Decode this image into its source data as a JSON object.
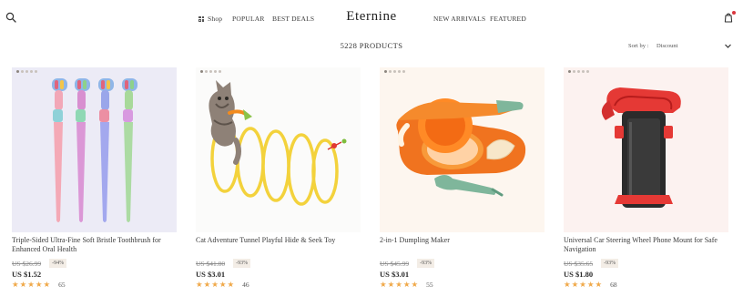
{
  "header": {
    "logo": "Eternine",
    "nav_left": [
      "Shop",
      "POPULAR",
      "BEST DEALS"
    ],
    "nav_right": [
      "NEW ARRIVALS",
      "FEATURED"
    ]
  },
  "toolbar": {
    "product_count": "5228 PRODUCTS",
    "sort_label": "Sort by :",
    "sort_value": "Discount"
  },
  "colors": {
    "star": "#f0a94a",
    "badge_bg": "#f3ede6"
  },
  "products": [
    {
      "title": "Triple-Sided Ultra-Fine Soft Bristle Toothbrush for Enhanced Oral Health",
      "old_price": "US $26.99",
      "discount": "-94%",
      "price": "US $1.52",
      "stars": 5,
      "reviews": "65"
    },
    {
      "title": "Cat Adventure Tunnel Playful Hide & Seek Toy",
      "old_price": "US $41.80",
      "discount": "-93%",
      "price": "US $3.01",
      "stars": 5,
      "reviews": "46"
    },
    {
      "title": "2-in-1 Dumpling Maker",
      "old_price": "US $45.99",
      "discount": "-93%",
      "price": "US $3.01",
      "stars": 5,
      "reviews": "55"
    },
    {
      "title": "Universal Car Steering Wheel Phone Mount for Safe Navigation",
      "old_price": "US $35.65",
      "discount": "-93%",
      "price": "US $1.80",
      "stars": 5,
      "reviews": "68"
    }
  ]
}
